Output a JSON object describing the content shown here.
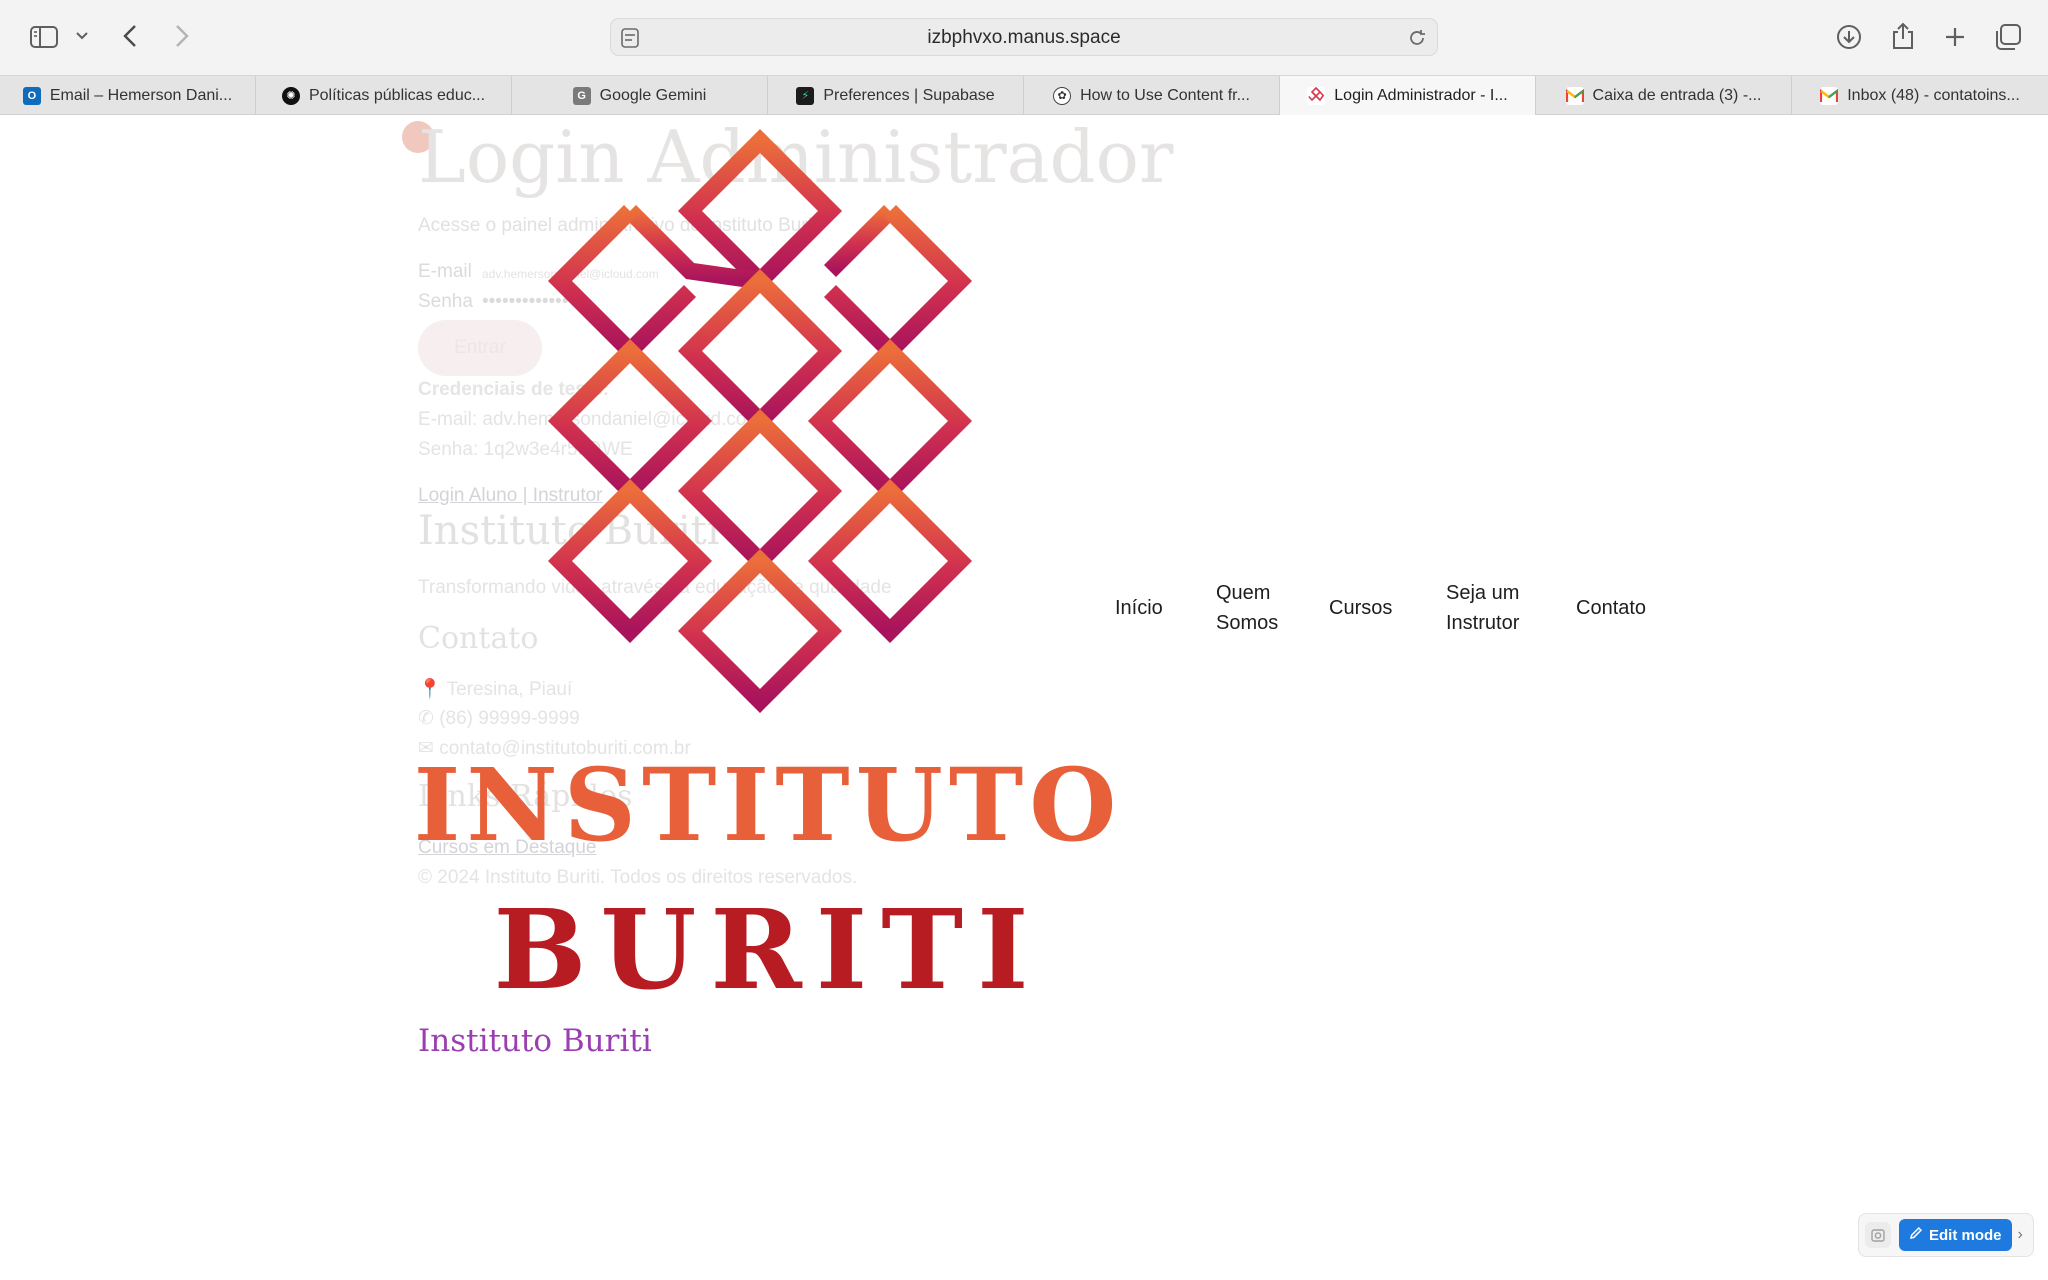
{
  "browser": {
    "url": "izbphvxo.manus.space",
    "icons": [
      "sidebar-icon",
      "chevron-down-icon",
      "back-icon",
      "forward-icon",
      "site-settings-icon",
      "reload-icon",
      "download-icon",
      "share-icon",
      "plus-icon",
      "tab-overview-icon"
    ],
    "tabs": [
      {
        "label": "Email – Hemerson Dani...",
        "favicon": "outlook-icon",
        "glyph": "O"
      },
      {
        "label": "Políticas públicas educ...",
        "favicon": "openai-icon",
        "glyph": "✺"
      },
      {
        "label": "Google Gemini",
        "favicon": "gemini-icon",
        "glyph": "G"
      },
      {
        "label": "Preferences | Supabase",
        "favicon": "supabase-icon",
        "glyph": "⚡"
      },
      {
        "label": "How to Use Content fr...",
        "favicon": "github-icon",
        "glyph": "✿"
      },
      {
        "label": "Login Administrador - I...",
        "favicon": "instituto-buriti-icon",
        "glyph": ""
      },
      {
        "label": "Caixa de entrada (3) -...",
        "favicon": "gmail-icon",
        "glyph": "M"
      },
      {
        "label": "Inbox (48) - contatoins...",
        "favicon": "gmail-icon",
        "glyph": "M"
      }
    ]
  },
  "ghost": {
    "title": "Login Administrador",
    "subtitle": "Acesse o painel administrativo do Instituto Buriti",
    "email_label": "E-mail",
    "email_value": "adv.hemersondaniel@icloud.com",
    "password_label": "Senha",
    "password_value": "••••••••••••••••",
    "submit": "Entrar",
    "credentials_title": "Credenciais de teste:",
    "credentials_email": "E-mail: adv.hemersondaniel@icloud.com",
    "credentials_password": "Senha: 1q2w3e4r5t@WE",
    "student_link": "Login Aluno | Instrutor",
    "footer_title": "Instituto Buriti",
    "footer_tagline": "Transformando vidas através da educação de qualidade",
    "contact_title": "Contato",
    "contact_city": "Teresina, Piauí",
    "contact_phone": "(86) 99999-9999",
    "contact_email": "contato@institutoburiti.com.br",
    "links_title": "Links Rápidos",
    "links_item": "Cursos em Destaque",
    "copyright": "© 2024 Instituto Buriti. Todos os direitos reservados."
  },
  "logo": {
    "line1": "INSTITUTO",
    "line2": "BURITI",
    "colors": {
      "top": "#ec6e3a",
      "bottom": "#a8135c",
      "instituto": "#e8603a",
      "buriti": "#b71c23"
    }
  },
  "brand_text": "Instituto Buriti",
  "nav": {
    "home": "Início",
    "about_line1": "Quem",
    "about_line2": "Somos",
    "courses": "Cursos",
    "instructor_line1": "Seja um",
    "instructor_line2": "Instrutor",
    "contact": "Contato"
  },
  "editor": {
    "edit_label": "Edit mode"
  }
}
